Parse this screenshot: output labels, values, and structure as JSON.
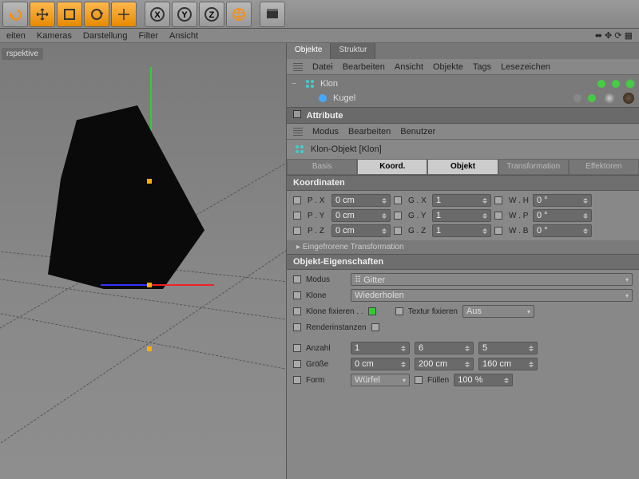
{
  "toolbar_icons": [
    "undo",
    "move",
    "select",
    "rotate",
    "move2",
    "x",
    "y",
    "z",
    "globe",
    "clapper",
    "render"
  ],
  "menubar": [
    "eiten",
    "Kameras",
    "Darstellung",
    "Filter",
    "Ansicht"
  ],
  "viewport_label": "rspektive",
  "panel": {
    "tabs": [
      "Objekte",
      "Struktur"
    ],
    "menu": [
      "Datei",
      "Bearbeiten",
      "Ansicht",
      "Objekte",
      "Tags",
      "Lesezeichen"
    ],
    "tree": [
      {
        "name": "Klon",
        "icon": "cloner"
      },
      {
        "name": "Kugel",
        "icon": "sphere"
      }
    ],
    "attr_header": "Attribute",
    "attr_menu": [
      "Modus",
      "Bearbeiten",
      "Benutzer"
    ],
    "object_type": "Klon-Objekt [Klon]",
    "attr_tabs": [
      "Basis",
      "Koord.",
      "Objekt",
      "Transformation",
      "Effektoren"
    ],
    "attr_tabs_sel": [
      1,
      2
    ],
    "koordinaten": {
      "title": "Koordinaten",
      "px": "0 cm",
      "gx": "1",
      "wh": "0 °",
      "py": "0 cm",
      "gy": "1",
      "wp": "0 °",
      "pz": "0 cm",
      "gz": "1",
      "wb": "0 °",
      "frozen": "Eingefrorene Transformation"
    },
    "objprops": {
      "title": "Objekt-Eigenschaften",
      "modus_label": "Modus",
      "modus": "Gitter",
      "klone_label": "Klone",
      "klone": "Wiederholen",
      "klone_fix": "Klone fixieren . .",
      "tex_fix": "Textur fixieren",
      "tex_val": "Aus",
      "render": "Renderinstanzen",
      "anzahl_label": "Anzahl",
      "anzahl": [
        "1",
        "6",
        "5"
      ],
      "groesse_label": "Größe",
      "groesse": [
        "0 cm",
        "200 cm",
        "160 cm"
      ],
      "form_label": "Form",
      "form": "Würfel",
      "fuellen_label": "Füllen",
      "fuellen": "100 %"
    }
  }
}
